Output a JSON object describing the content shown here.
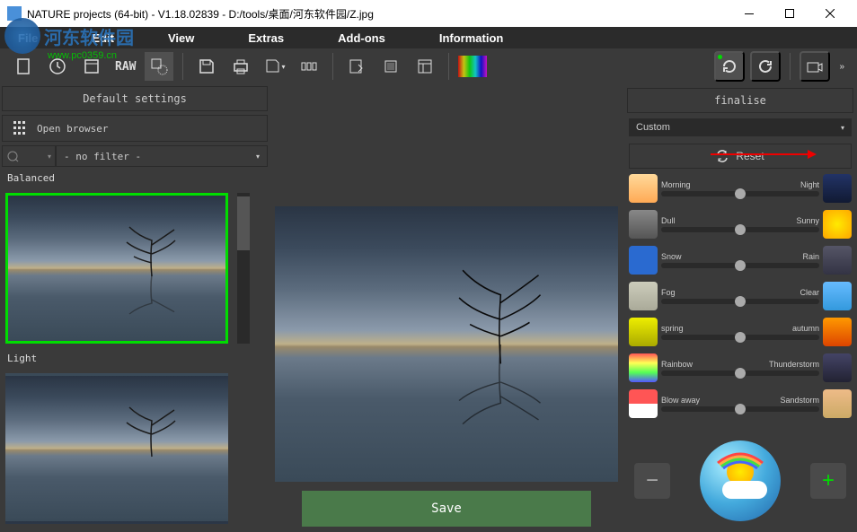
{
  "titlebar": {
    "text": "NATURE projects (64-bit) - V1.18.02839 - D:/tools/桌面/河东软件园/Z.jpg"
  },
  "watermark": {
    "text": "河东软件园",
    "url": "www.pc0359.cn"
  },
  "menu": {
    "file": "File",
    "edit": "Edit",
    "view": "View",
    "extras": "Extras",
    "addons": "Add-ons",
    "information": "Information"
  },
  "toolbar": {
    "raw_label": "RAW"
  },
  "left": {
    "default_settings": "Default settings",
    "open_browser": "Open browser",
    "no_filter": "- no filter -",
    "balanced": "Balanced",
    "light": "Light"
  },
  "center": {
    "save": "Save"
  },
  "right": {
    "finalise": "finalise",
    "custom": "Custom",
    "reset": "Reset",
    "sliders": [
      {
        "left": "Morning",
        "right": "Night",
        "licon": "linear-gradient(#ffd99a,#ffaa55)",
        "ricon": "linear-gradient(#223366,#111a33)"
      },
      {
        "left": "Dull",
        "right": "Sunny",
        "licon": "linear-gradient(#888,#555)",
        "ricon": "radial-gradient(#ffea00,#ffa500)"
      },
      {
        "left": "Snow",
        "right": "Rain",
        "licon": "#2a6ad0",
        "ricon": "linear-gradient(#556,#334)"
      },
      {
        "left": "Fog",
        "right": "Clear",
        "licon": "linear-gradient(#ccb,#aa9)",
        "ricon": "linear-gradient(#6bf,#39d)"
      },
      {
        "left": "spring",
        "right": "autumn",
        "licon": "linear-gradient(#ee0,#aa0)",
        "ricon": "linear-gradient(#f90,#d40)"
      },
      {
        "left": "Rainbow",
        "right": "Thunderstorm",
        "licon": "linear-gradient(#f55,#ff5 33%,#5f5 66%,#55f)",
        "ricon": "linear-gradient(#446,#223)"
      },
      {
        "left": "Blow away",
        "right": "Sandstorm",
        "licon": "linear-gradient(#f55 50%,#fff 50%)",
        "ricon": "linear-gradient(#eb8,#ca6)"
      }
    ]
  }
}
